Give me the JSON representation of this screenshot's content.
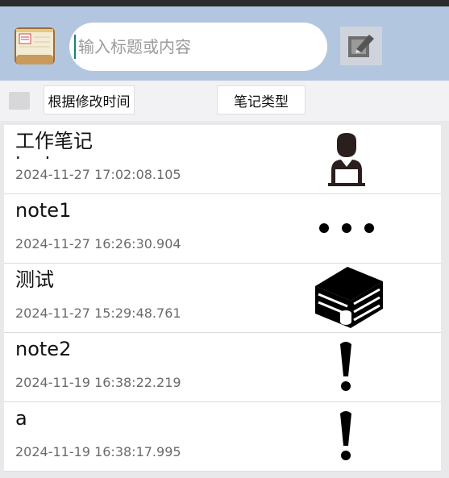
{
  "header": {
    "search_placeholder": "输入标题或内容"
  },
  "toolbar": {
    "sort_label": "根据修改时间",
    "type_label": "笔记类型"
  },
  "notes": [
    {
      "title": "工作笔记",
      "subtitle": "test",
      "time": "2024-11-27 17:02:08.105",
      "icon": "person-laptop-icon"
    },
    {
      "title": "note1",
      "time": "2024-11-27 16:26:30.904",
      "icon": "ellipsis-icon"
    },
    {
      "title": "测试",
      "time": "2024-11-27 15:29:48.761",
      "icon": "server-icon"
    },
    {
      "title": "note2",
      "time": "2024-11-19 16:38:22.219",
      "icon": "exclamation-icon"
    },
    {
      "title": "a",
      "time": "2024-11-19 16:38:17.995",
      "icon": "exclamation-icon"
    }
  ],
  "colors": {
    "header_bg": "#b3c6df",
    "status_bar": "#2b2b2d",
    "caret": "#1a7f7a"
  }
}
